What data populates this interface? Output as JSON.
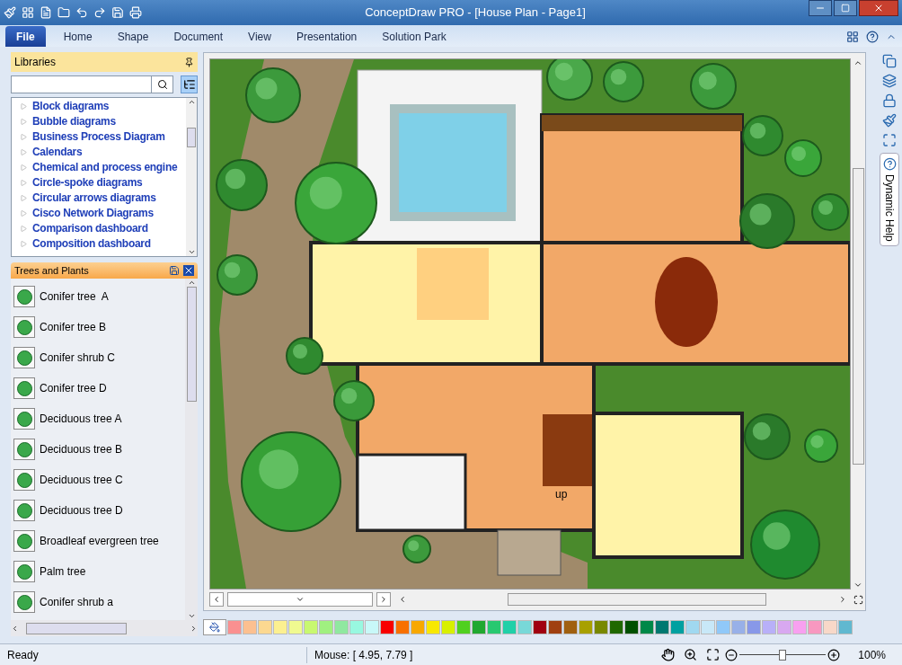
{
  "window": {
    "title": "ConceptDraw PRO - [House Plan - Page1]"
  },
  "ribbon_tabs": [
    {
      "label": "File",
      "selected": true
    },
    {
      "label": "Home",
      "selected": false
    },
    {
      "label": "Shape",
      "selected": false
    },
    {
      "label": "Document",
      "selected": false
    },
    {
      "label": "View",
      "selected": false
    },
    {
      "label": "Presentation",
      "selected": false
    },
    {
      "label": "Solution Park",
      "selected": false
    }
  ],
  "libraries": {
    "title": "Libraries",
    "items": [
      "Block diagrams",
      "Bubble diagrams",
      "Business Process Diagram",
      "Calendars",
      "Chemical and process engine",
      "Circle-spoke diagrams",
      "Circular arrows diagrams",
      "Cisco Network Diagrams",
      "Comparison dashboard",
      "Composition dashboard"
    ]
  },
  "library_panel": {
    "title": "Trees and Plants",
    "items": [
      "Conifer tree  A",
      "Conifer tree B",
      "Conifer shrub C",
      "Conifer tree D",
      "Deciduous tree A",
      "Deciduous tree B",
      "Deciduous tree C",
      "Deciduous tree D",
      "Broadleaf evergreen tree",
      "Palm tree",
      "Conifer shrub a"
    ]
  },
  "canvas": {
    "labels": [
      "up"
    ]
  },
  "side_tab": {
    "label": "Dynamic Help"
  },
  "palette": [
    {
      "color": "#fa9090"
    },
    {
      "color": "#fcc090"
    },
    {
      "color": "#fcd890"
    },
    {
      "color": "#fcf090"
    },
    {
      "color": "#f0fa90"
    },
    {
      "color": "#c8f870"
    },
    {
      "color": "#a0f080"
    },
    {
      "color": "#90e8a0"
    },
    {
      "color": "#98f8e0"
    },
    {
      "color": "#c8f8f8"
    },
    {
      "color": "#f80000"
    },
    {
      "color": "#f87000"
    },
    {
      "color": "#f8a800"
    },
    {
      "color": "#f8e800"
    },
    {
      "color": "#d8f000"
    },
    {
      "color": "#50d020"
    },
    {
      "color": "#20a830"
    },
    {
      "color": "#28c870"
    },
    {
      "color": "#20d0a8"
    },
    {
      "color": "#78d8d8"
    },
    {
      "color": "#a00010"
    },
    {
      "color": "#a04010"
    },
    {
      "color": "#a06010"
    },
    {
      "color": "#a8a000"
    },
    {
      "color": "#788800"
    },
    {
      "color": "#206800"
    },
    {
      "color": "#005000"
    },
    {
      "color": "#008848"
    },
    {
      "color": "#007870"
    },
    {
      "color": "#00a0a0"
    },
    {
      "color": "#a0d8f0"
    },
    {
      "color": "#c8e8f8"
    },
    {
      "color": "#90c8f8"
    },
    {
      "color": "#98b0e8"
    },
    {
      "color": "#8898e8"
    },
    {
      "color": "#b8b0f8"
    },
    {
      "color": "#d8a8f0"
    },
    {
      "color": "#f8a0f0"
    },
    {
      "color": "#f898c0"
    },
    {
      "color": "#f8d8c8"
    },
    {
      "color": "#60b8d0"
    }
  ],
  "status_bar": {
    "status": "Ready",
    "mouse": "Mouse: [ 4.95, 7.79 ]",
    "zoom": {
      "level": 0.5,
      "reading": "100%"
    }
  }
}
